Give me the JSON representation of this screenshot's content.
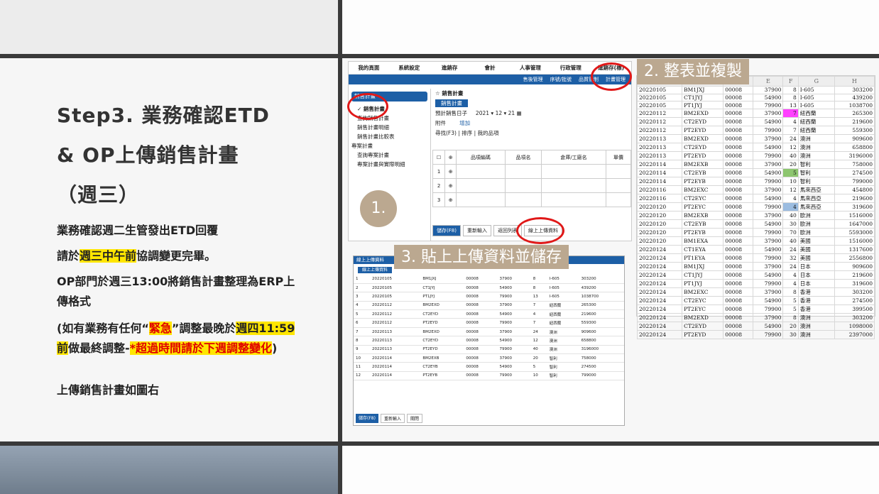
{
  "slide": {
    "title_lines": [
      "Step3. 業務確認ETD",
      "& OP上傳銷售計畫",
      "（週三）"
    ],
    "p1": "業務確認週二生管發出ETD回覆",
    "p2_pre": "請於",
    "p2_hl": "週三中午前",
    "p2_post": "協調變更完畢。",
    "p3": "OP部門於週三13:00將銷售計畫整理為ERP上傳格式",
    "p4_a": "(如有業務有任何“",
    "p4_b": "緊急",
    "p4_c": "”調整最晚於",
    "p4_d": "週四11:59前",
    "p4_e": "做最終調整-",
    "p4_f": "*超過時間請於下週調整變化",
    "p4_g": ")",
    "p5": "上傳銷售計畫如圖右"
  },
  "labels": {
    "step1": "1.",
    "step2": "2. 整表並複製",
    "step3": "3. 貼上上傳資料並儲存"
  },
  "erp": {
    "menu": [
      "我的頁面",
      "系統設定",
      "進銷存",
      "會計",
      "人事管理",
      "行政管理",
      "進銷存(標)"
    ],
    "submenu": [
      "售後管理",
      "序號/批號",
      "品質管制",
      "計畫管理"
    ],
    "sidebar": [
      "銷售計畫",
      "銷售計畫",
      "查詢銷售計畫",
      "銷售計畫明細",
      "銷售計畫比較表",
      "專案計畫",
      "查詢專案計畫",
      "專案計畫與實際明細"
    ],
    "page_title": "銷售計畫",
    "tab": "銷售計畫",
    "date_label": "預計銷售日子",
    "year": "2021",
    "month": "12",
    "day": "21",
    "attach": "附件",
    "add": "增加",
    "tools": [
      "尋找(F3)",
      "排序",
      "我的品項"
    ],
    "cols": [
      "品項編碼",
      "品項名",
      "倉庫/工廠名",
      "單價"
    ],
    "rows": [
      "1",
      "2",
      "3"
    ],
    "buttons": [
      "儲存(F8)",
      "重新輸入",
      "返回列表",
      "線上上傳資料"
    ]
  },
  "sheet": {
    "headers": [
      "",
      "E",
      "F",
      "G",
      "H"
    ],
    "rows": [
      [
        "20220105",
        "BM1JXJ",
        "00008",
        "37900",
        "8",
        "I-605",
        "303200"
      ],
      [
        "20220105",
        "CT1JYJ",
        "00008",
        "54900",
        "8",
        "I-605",
        "439200"
      ],
      [
        "20220105",
        "PT1JYJ",
        "00008",
        "79900",
        "13",
        "I-605",
        "1038700"
      ],
      [
        "20220112",
        "BM2EXD",
        "00008",
        "37900",
        "7",
        "紐西蘭",
        "265300"
      ],
      [
        "20220112",
        "CT2EYD",
        "00008",
        "54900",
        "4",
        "紐西蘭",
        "219600"
      ],
      [
        "20220112",
        "PT2EYD",
        "00008",
        "79900",
        "7",
        "紐西蘭",
        "559300"
      ],
      [
        "20220113",
        "BM2EXD",
        "00008",
        "37900",
        "24",
        "澳洲",
        "909600"
      ],
      [
        "20220113",
        "CT2EYD",
        "00008",
        "54900",
        "12",
        "澳洲",
        "658800"
      ],
      [
        "20220113",
        "PT2EYD",
        "00008",
        "79900",
        "40",
        "澳洲",
        "3196000"
      ],
      [
        "20220114",
        "BM2EXB",
        "00008",
        "37900",
        "20",
        "智利",
        "758000"
      ],
      [
        "20220114",
        "CT2EYB",
        "00008",
        "54900",
        "5",
        "智利",
        "274500"
      ],
      [
        "20220114",
        "PT2EYB",
        "00008",
        "79900",
        "10",
        "智利",
        "799000"
      ],
      [
        "20220116",
        "BM2EXC",
        "00008",
        "37900",
        "12",
        "馬來西亞",
        "454800"
      ],
      [
        "20220116",
        "CT2EYC",
        "00008",
        "54900",
        "4",
        "馬來西亞",
        "219600"
      ],
      [
        "20220120",
        "PT2EYC",
        "00008",
        "79900",
        "4",
        "馬來西亞",
        "319600"
      ],
      [
        "20220120",
        "BM2EXB",
        "00008",
        "37900",
        "40",
        "歐洲",
        "1516000"
      ],
      [
        "20220120",
        "CT2EYB",
        "00008",
        "54900",
        "30",
        "歐洲",
        "1647000"
      ],
      [
        "20220120",
        "PT2EYB",
        "00008",
        "79900",
        "70",
        "歐洲",
        "5593000"
      ],
      [
        "20220120",
        "BM1EXA",
        "00008",
        "37900",
        "40",
        "美國",
        "1516000"
      ],
      [
        "20220124",
        "CT1EYA",
        "00008",
        "54900",
        "24",
        "美國",
        "1317600"
      ],
      [
        "20220124",
        "PT1EYA",
        "00008",
        "79900",
        "32",
        "美國",
        "2556800"
      ],
      [
        "20220124",
        "BM1JXJ",
        "00008",
        "37900",
        "24",
        "日本",
        "909600"
      ],
      [
        "20220124",
        "CT1JYJ",
        "00008",
        "54900",
        "4",
        "日本",
        "219600"
      ],
      [
        "20220124",
        "PT1JYJ",
        "00008",
        "79900",
        "4",
        "日本",
        "319600"
      ],
      [
        "20220124",
        "BM2EXC",
        "00008",
        "37900",
        "8",
        "香港",
        "303200"
      ],
      [
        "20220124",
        "CT2EYC",
        "00008",
        "54900",
        "5",
        "香港",
        "274500"
      ],
      [
        "20220124",
        "PT2EYC",
        "00008",
        "79900",
        "5",
        "香港",
        "399500"
      ],
      [
        "20220124",
        "BM2EXD",
        "00008",
        "37900",
        "8",
        "澳洲",
        "303200"
      ],
      [
        "20220124",
        "CT2EYD",
        "00008",
        "54900",
        "20",
        "澳洲",
        "1098000"
      ],
      [
        "20220124",
        "PT2EYD",
        "00008",
        "79900",
        "30",
        "澳洲",
        "2397000"
      ]
    ]
  },
  "upload": {
    "title": "線上上傳資料",
    "tab": "線上上傳資料",
    "buttons": [
      "儲存(F8)",
      "重新輸入",
      "關閉"
    ],
    "rows": [
      [
        "1",
        "20220105",
        "BM1JXJ",
        "00008",
        "37900",
        "8",
        "I-605",
        "303200"
      ],
      [
        "2",
        "20220105",
        "CT1JYJ",
        "00008",
        "54900",
        "8",
        "I-605",
        "439200"
      ],
      [
        "3",
        "20220105",
        "PT1JYJ",
        "00008",
        "79900",
        "13",
        "I-605",
        "1038700"
      ],
      [
        "4",
        "20220112",
        "BM2EXD",
        "00008",
        "37900",
        "7",
        "紐西蘭",
        "265300"
      ],
      [
        "5",
        "20220112",
        "CT2EYD",
        "00008",
        "54900",
        "4",
        "紐西蘭",
        "219600"
      ],
      [
        "6",
        "20220112",
        "PT2EYD",
        "00008",
        "79900",
        "7",
        "紐西蘭",
        "559300"
      ],
      [
        "7",
        "20220113",
        "BM2EXD",
        "00008",
        "37900",
        "24",
        "澳洲",
        "909600"
      ],
      [
        "8",
        "20220113",
        "CT2EYD",
        "00008",
        "54900",
        "12",
        "澳洲",
        "658800"
      ],
      [
        "9",
        "20220113",
        "PT2EYD",
        "00008",
        "79900",
        "40",
        "澳洲",
        "3196000"
      ],
      [
        "10",
        "20220114",
        "BM2EXB",
        "00008",
        "37900",
        "20",
        "智利",
        "758000"
      ],
      [
        "11",
        "20220114",
        "CT2EYB",
        "00008",
        "54900",
        "5",
        "智利",
        "274500"
      ],
      [
        "12",
        "20220114",
        "PT2EYB",
        "00008",
        "79900",
        "10",
        "智利",
        "799000"
      ]
    ]
  }
}
